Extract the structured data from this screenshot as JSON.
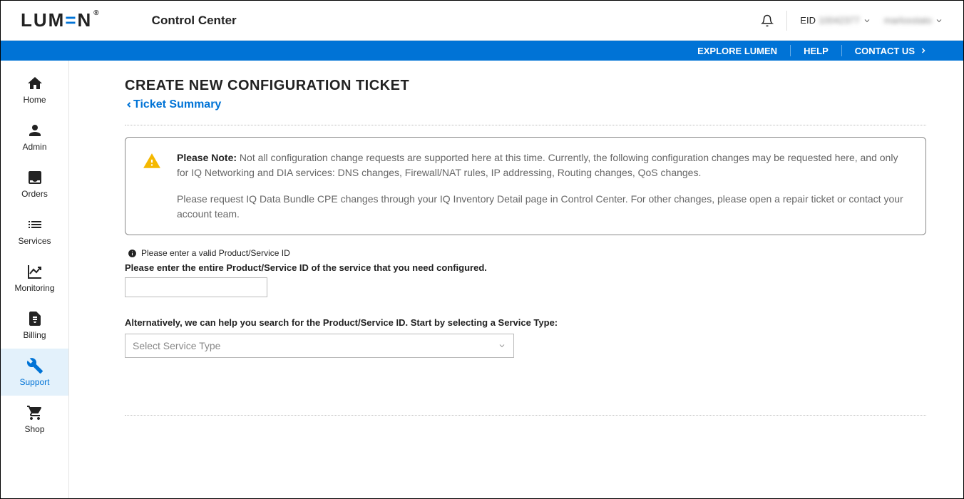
{
  "header": {
    "logo_text": "LUM=N",
    "app_title": "Control Center",
    "eid_label": "EID",
    "eid_value": "10042377",
    "user_name": "marlosstato"
  },
  "bluebar": {
    "explore": "EXPLORE LUMEN",
    "help": "HELP",
    "contact": "CONTACT US"
  },
  "sidebar": {
    "items": [
      {
        "label": "Home"
      },
      {
        "label": "Admin"
      },
      {
        "label": "Orders"
      },
      {
        "label": "Services"
      },
      {
        "label": "Monitoring"
      },
      {
        "label": "Billing"
      },
      {
        "label": "Support"
      },
      {
        "label": "Shop"
      }
    ]
  },
  "page": {
    "title": "CREATE NEW CONFIGURATION TICKET",
    "breadcrumb": "Ticket Summary",
    "notice_strong": "Please Note:",
    "notice_p1": " Not all configuration change requests are supported here at this time. Currently, the following configuration changes may be requested here, and only for IQ Networking and DIA services: DNS changes, Firewall/NAT rules, IP addressing, Routing changes, QoS changes.",
    "notice_p2": "Please request IQ Data Bundle CPE changes through your IQ Inventory Detail page in Control Center. For other changes, please open a repair ticket or contact your account team.",
    "error_msg": "Please enter a valid Product/Service ID",
    "field_label": "Please enter the entire Product/Service ID of the service that you need configured.",
    "alt_label": "Alternatively, we can help you search for the Product/Service ID. Start by selecting a Service Type:",
    "select_placeholder": "Select Service Type"
  }
}
